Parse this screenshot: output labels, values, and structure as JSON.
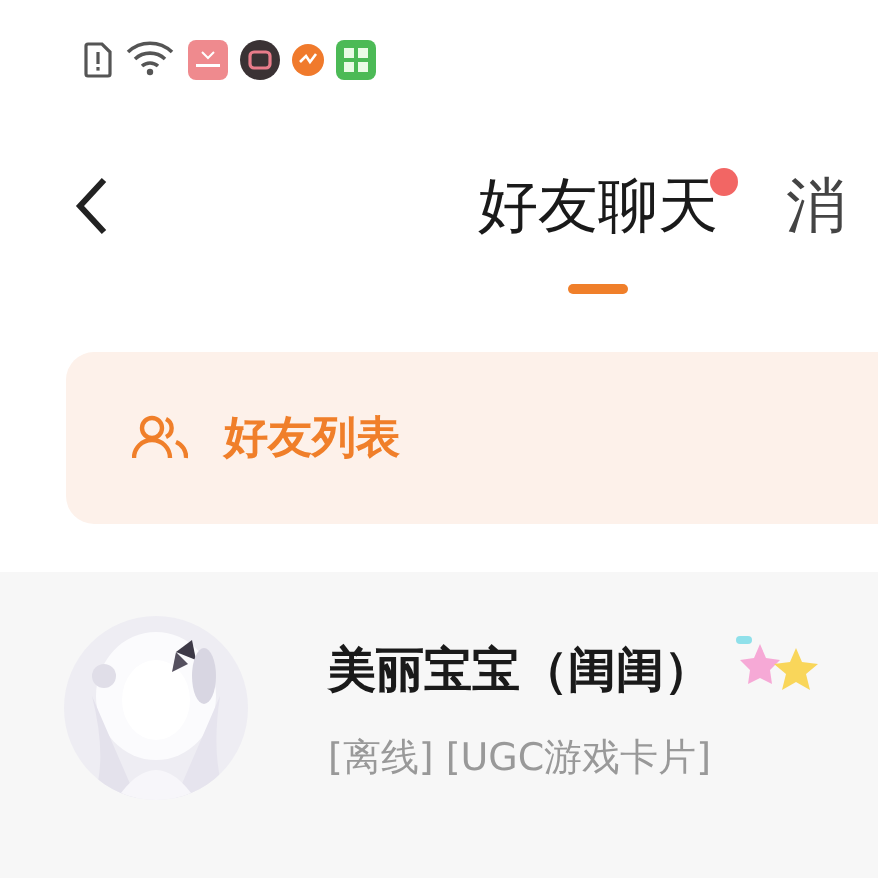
{
  "header": {
    "tabs": [
      {
        "label": "好友聊天",
        "selected": true,
        "badge": true
      },
      {
        "label": "消",
        "selected": false,
        "badge": false
      }
    ]
  },
  "section": {
    "title": "好友列表"
  },
  "friends": [
    {
      "name": "美丽宝宝（闺闺）",
      "status": "[离线] [UGC游戏卡片]"
    }
  ]
}
